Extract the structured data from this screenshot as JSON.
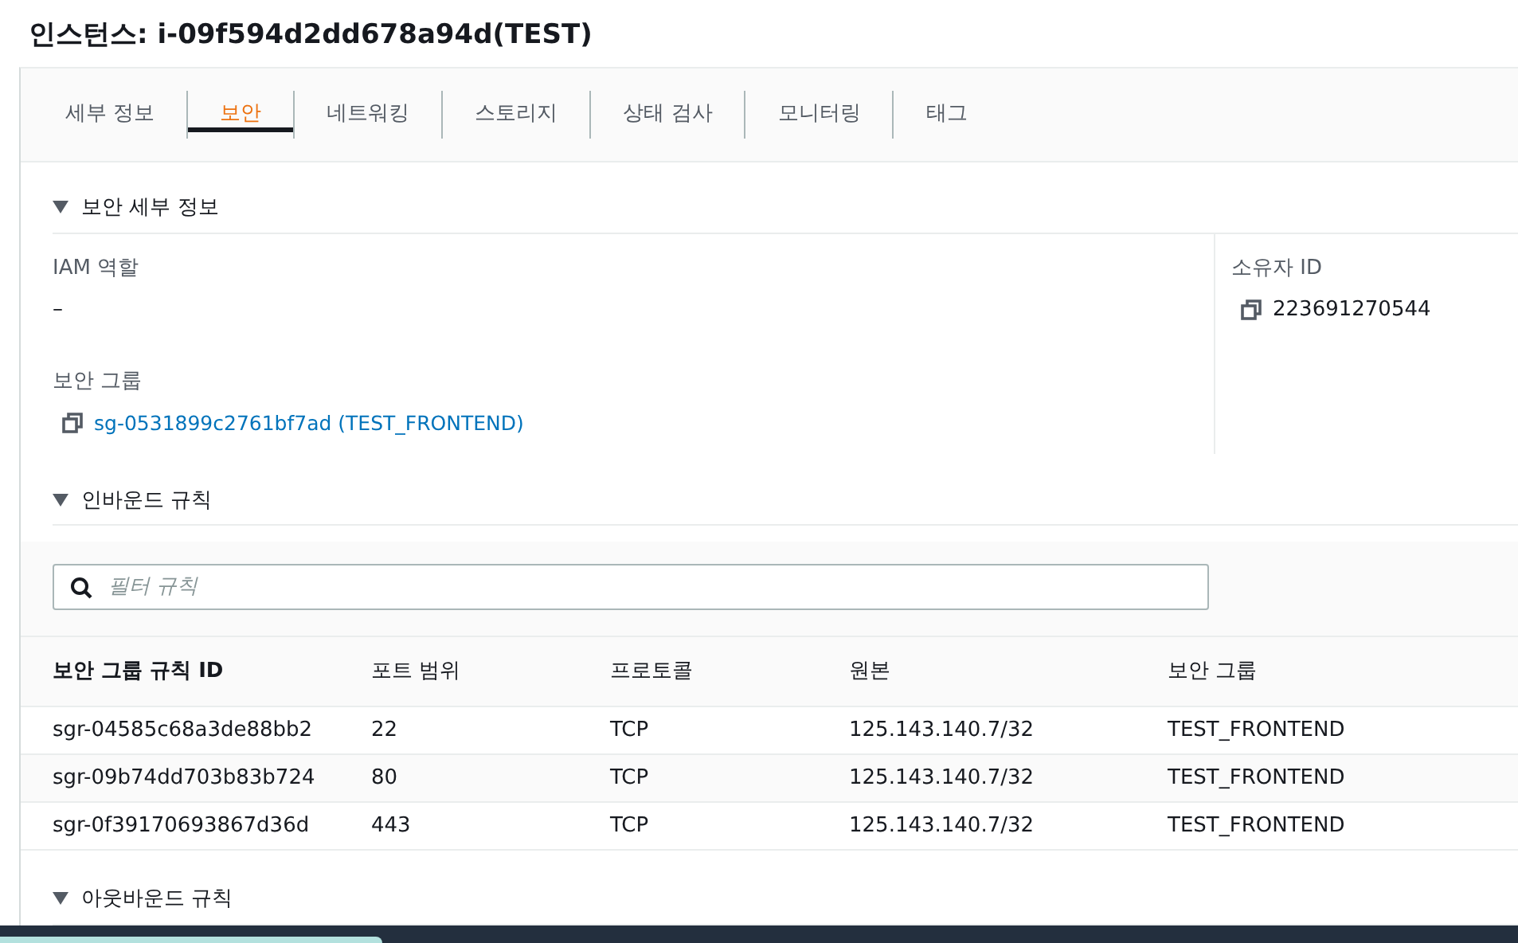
{
  "title": "인스턴스: i-09f594d2dd678a94d(TEST)",
  "tabs": [
    {
      "label": "세부 정보",
      "selected": false
    },
    {
      "label": "보안",
      "selected": true
    },
    {
      "label": "네트워킹",
      "selected": false
    },
    {
      "label": "스토리지",
      "selected": false
    },
    {
      "label": "상태 검사",
      "selected": false
    },
    {
      "label": "모니터링",
      "selected": false
    },
    {
      "label": "태그",
      "selected": false
    }
  ],
  "security_details": {
    "heading": "보안 세부 정보",
    "expanded": true,
    "iam_role_label": "IAM 역할",
    "iam_role_value": "–",
    "security_groups_label": "보안 그룹",
    "security_group_link": "sg-0531899c2761bf7ad (TEST_FRONTEND)",
    "owner_id_label": "소유자 ID",
    "owner_id_value": "223691270544"
  },
  "inbound_rules": {
    "heading": "인바운드 규칙",
    "expanded": true,
    "filter": {
      "placeholder": "필터 규칙"
    },
    "columns": [
      "보안 그룹 규칙 ID",
      "포트 범위",
      "프로토콜",
      "원본",
      "보안 그룹"
    ],
    "rows": [
      [
        "sgr-04585c68a3de88bb2",
        "22",
        "TCP",
        "125.143.140.7/32",
        "TEST_FRONTEND"
      ],
      [
        "sgr-09b74dd703b83b724",
        "80",
        "TCP",
        "125.143.140.7/32",
        "TEST_FRONTEND"
      ],
      [
        "sgr-0f39170693867d36d",
        "443",
        "TCP",
        "125.143.140.7/32",
        "TEST_FRONTEND"
      ]
    ]
  },
  "outbound_rules": {
    "heading": "아웃바운드 규칙",
    "expanded": true
  }
}
